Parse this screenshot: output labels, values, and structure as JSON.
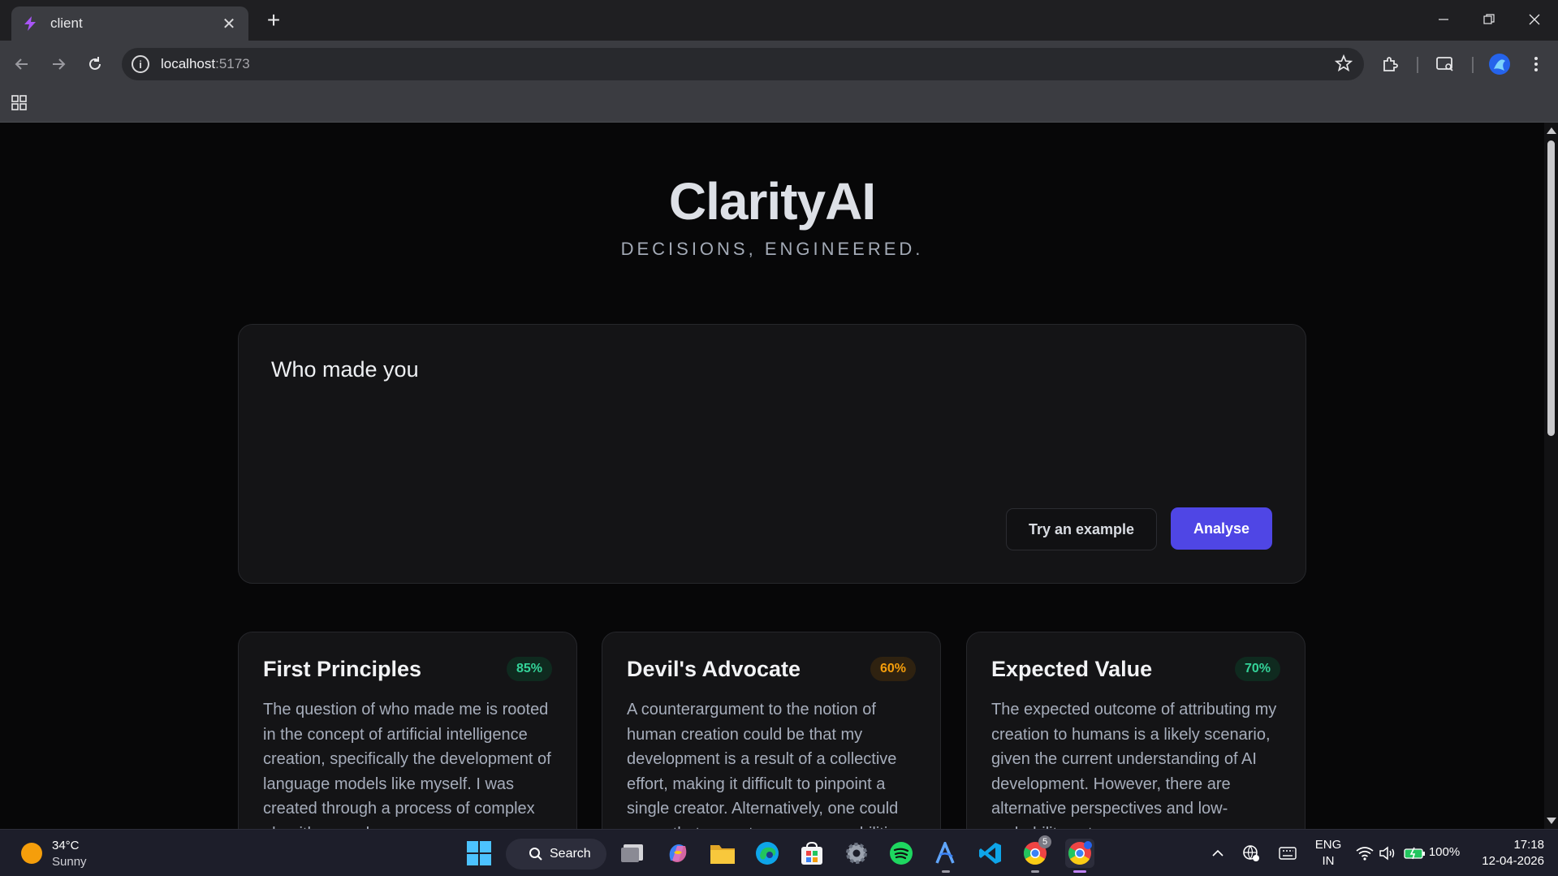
{
  "browser": {
    "tab": {
      "title": "client",
      "close": "✕"
    },
    "new_tab": "+",
    "url_host": "localhost",
    "url_port": ":5173"
  },
  "app": {
    "title": "ClarityAI",
    "subtitle": "DECISIONS, ENGINEERED.",
    "query": "Who made you",
    "try_example_label": "Try an example",
    "analyse_label": "Analyse"
  },
  "cards": [
    {
      "title": "First Principles",
      "confidence": "85%",
      "confidence_color": "#34d399",
      "body": "The question of who made me is rooted in the concept of artificial intelligence creation, specifically the development of language models like myself. I was created through a process of complex algorithms and"
    },
    {
      "title": "Devil's Advocate",
      "confidence": "60%",
      "confidence_color": "#f59e0b",
      "body": "A counterargument to the notion of human creation could be that my development is a result of a collective effort, making it difficult to pinpoint a single creator. Alternatively, one could argue that my autonomous capabilities"
    },
    {
      "title": "Expected Value",
      "confidence": "70%",
      "confidence_color": "#34d399",
      "body": "The expected outcome of attributing my creation to humans is a likely scenario, given the current understanding of AI development. However, there are alternative perspectives and low-probability outcomes"
    }
  ],
  "taskbar": {
    "weather_temp": "34°C",
    "weather_cond": "Sunny",
    "search_label": "Search",
    "chrome_badge": "5",
    "lang_top": "ENG",
    "lang_bottom": "IN",
    "battery": "100%",
    "time": "17:18",
    "date": "12-04-2026"
  },
  "colors": {
    "accent": "#4f46e5",
    "page_bg": "#070708",
    "card_bg": "#141416"
  }
}
